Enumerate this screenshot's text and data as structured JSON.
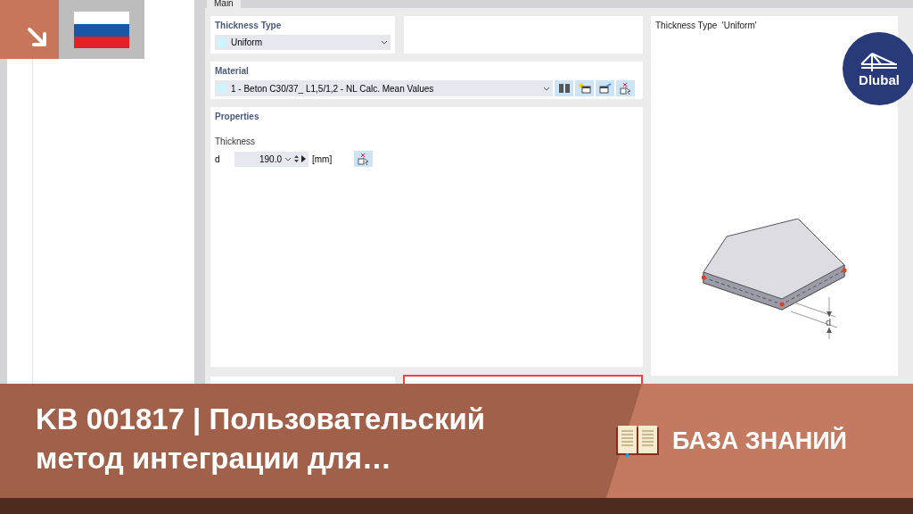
{
  "tab": {
    "label": "Main",
    "selected": true
  },
  "thickness_type": {
    "title": "Thickness Type",
    "value": "Uniform"
  },
  "material": {
    "title": "Material",
    "value": "1 - Beton C30/37_ L1,5/1,2 - NL Calc. Mean Values"
  },
  "properties": {
    "title": "Properties",
    "group": "Thickness",
    "symbol": "d",
    "value": "190.0",
    "unit": "[mm]"
  },
  "preview": {
    "caption": "Thickness Type  'Uniform'",
    "dimension_label": "d"
  },
  "logo": {
    "text": "Dlubal"
  },
  "banner": {
    "title": "KB 001817 | Пользовательский метод интеграции для…",
    "category": "БАЗА ЗНАНИЙ"
  }
}
